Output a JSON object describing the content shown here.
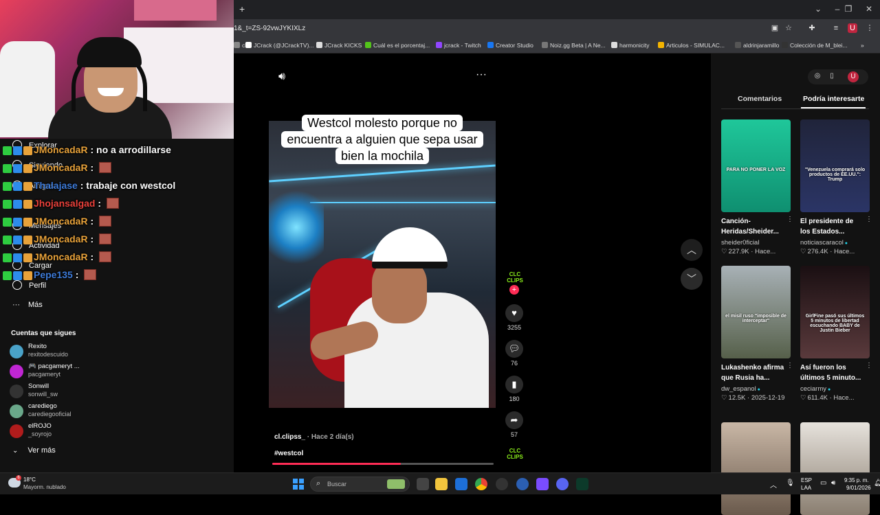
{
  "browser": {
    "url": "1&_t=ZS-92vwJYKIXLz",
    "bookmarks": [
      {
        "label": "ch",
        "color": "#888"
      },
      {
        "label": "JCrack (@JCrackTV)...",
        "color": "#fff"
      },
      {
        "label": "JCrack KICKS",
        "color": "#ddd"
      },
      {
        "label": "Cuál es el porcentaj...",
        "color": "#53c41a"
      },
      {
        "label": "jcrack - Twitch",
        "color": "#9146ff"
      },
      {
        "label": "Creator Studio",
        "color": "#1877f2"
      },
      {
        "label": "Noiz.gg Beta | A Ne...",
        "color": "#777"
      },
      {
        "label": "harmonicity",
        "color": "#ddd"
      },
      {
        "label": "Articulos - SIMULAC...",
        "color": "#f4b400"
      },
      {
        "label": "aldrinjaramillo",
        "color": "#555"
      },
      {
        "label": "Colección de M_blei...",
        "color": "#333"
      }
    ]
  },
  "sidebar": {
    "nav": [
      "Explorar",
      "Siguiendo",
      "Amigos",
      "Mensajes",
      "Actividad",
      "Cargar",
      "Perfil"
    ],
    "more_label": "Más",
    "following_title": "Cuentas que sigues",
    "accounts": [
      {
        "name": "Rexito",
        "handle": "rexitodescuido",
        "color": "#4aa3c9"
      },
      {
        "name": "🎮 pacgameryt ...",
        "handle": "pacgameryt",
        "color": "#c026d3"
      },
      {
        "name": "Sonwill",
        "handle": "sonwill_sw",
        "color": "#333"
      },
      {
        "name": "carediego",
        "handle": "carediegooficial",
        "color": "#6aa88a"
      },
      {
        "name": "elROJO",
        "handle": "_soyrojo",
        "color": "#b01c1c"
      }
    ],
    "see_more": "Ver más"
  },
  "chat": [
    {
      "user": "JMoncadaR",
      "color": "#e8a23a",
      "msg": "no a arrodillarse",
      "emote": false
    },
    {
      "user": "JMoncadaR",
      "color": "#e8a23a",
      "msg": "",
      "emote": true
    },
    {
      "user": "Thalajase",
      "color": "#3d7bd9",
      "msg": "trabaje con westcol",
      "emote": false
    },
    {
      "user": "Jhojansalgad",
      "color": "#e8403a",
      "msg": "",
      "emote": true
    },
    {
      "user": "JMoncadaR",
      "color": "#e8a23a",
      "msg": "",
      "emote": true
    },
    {
      "user": "JMoncadaR",
      "color": "#e8a23a",
      "msg": "",
      "emote": true
    },
    {
      "user": "JMoncadaR",
      "color": "#e8a23a",
      "msg": "",
      "emote": true
    },
    {
      "user": "Pepe135",
      "color": "#3d7bd9",
      "msg": "",
      "emote": true
    }
  ],
  "video": {
    "caption": "Westcol molesto porque no encuentra a alguien que sepa usar bien la mochila",
    "author": "cl.clipss_",
    "ago": "· Hace 2 día(s)",
    "hashtag": "#westcol",
    "progress": 0.58,
    "brand": "CLC CLIPS",
    "likes": "3255",
    "comments": "76",
    "saves": "180",
    "shares": "57"
  },
  "right_panel": {
    "tabs": [
      "Comentarios",
      "Podría interesarte"
    ],
    "active_tab": 1,
    "cards": [
      {
        "title": "Canción-Heridas/Sheider...",
        "author": "sheider0ficial",
        "verified": false,
        "likes": "227.9K",
        "when": "Hace...",
        "thumb_text": "PARA NO PONER LA VOZ",
        "bg": "linear-gradient(180deg,#1fc79a,#0f8f70)"
      },
      {
        "title": "El presidente de los Estados...",
        "author": "noticiascaracol",
        "verified": true,
        "likes": "276.4K",
        "when": "Hace...",
        "thumb_text": "\"Venezuela comprará solo productos de EE.UU.\": Trump",
        "bg": "linear-gradient(180deg,#20243a,#2b3566)"
      },
      {
        "title": "Lukashenko afirma que Rusia ha...",
        "author": "dw_espanol",
        "verified": true,
        "likes": "12.5K",
        "when": "2025-12-19",
        "thumb_text": "el misil ruso \"imposible de interceptar\"",
        "bg": "linear-gradient(180deg,#a8b1b6,#56604a)"
      },
      {
        "title": "Así fueron los últimos 5 minuto...",
        "author": "ceciarmy",
        "verified": true,
        "likes": "611.4K",
        "when": "Hace...",
        "thumb_text": "GirlFine pasó sus últimos 5 minutos de libertad escuchando BABY de Justin Bieber",
        "bg": "linear-gradient(180deg,#1a0f12,#5a3a3c)"
      },
      {
        "title": "",
        "author": "",
        "verified": false,
        "likes": "",
        "when": "",
        "thumb_text": "",
        "bg": "linear-gradient(180deg,#c9b7a6,#6a5a4c)"
      },
      {
        "title": "",
        "author": "",
        "verified": false,
        "likes": "",
        "when": "",
        "thumb_text": "",
        "bg": "linear-gradient(180deg,#e6e2dc,#8a7e70)"
      }
    ]
  },
  "taskbar": {
    "temp": "18°C",
    "weather": "Mayorm. nublado",
    "weather_badge": "6",
    "search_placeholder": "Buscar",
    "lang1": "ESP",
    "lang2": "LAA",
    "time": "9:35 p. m.",
    "date": "9/01/2026"
  }
}
